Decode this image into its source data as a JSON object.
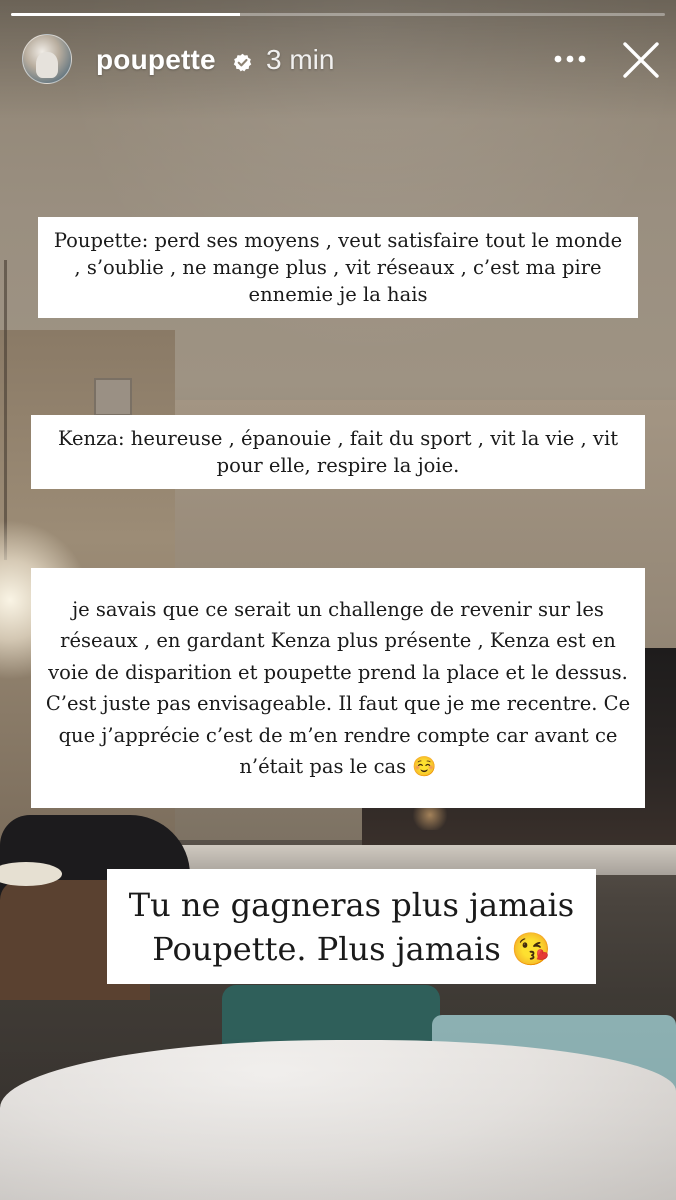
{
  "story": {
    "progress": 0.35,
    "username": "poupette",
    "timestamp": "3 min",
    "verified": true,
    "avatar_icon": "profile-photo",
    "more_icon": "more-horizontal-icon",
    "close_icon": "close-icon",
    "accent_color": "#ffffff"
  },
  "captions": [
    {
      "text": "Poupette: perd ses moyens , veut satisfaire tout le monde , s’oublie , ne mange plus , vit réseaux , c’est ma pire ennemie je la hais"
    },
    {
      "text": "Kenza: heureuse , épanouie , fait du sport , vit la vie , vit pour elle, respire la joie."
    },
    {
      "text": "je savais que ce serait un challenge de revenir sur les réseaux , en gardant Kenza plus présente , Kenza est en voie de disparition et poupette prend la place et le dessus. C’est juste pas envisageable. Il faut que je me recentre. Ce que j’apprécie c’est de m’en rendre compte car avant ce n’était pas le cas ☺️"
    },
    {
      "text": "Tu ne gagneras plus jamais Poupette. Plus jamais 😘"
    }
  ]
}
